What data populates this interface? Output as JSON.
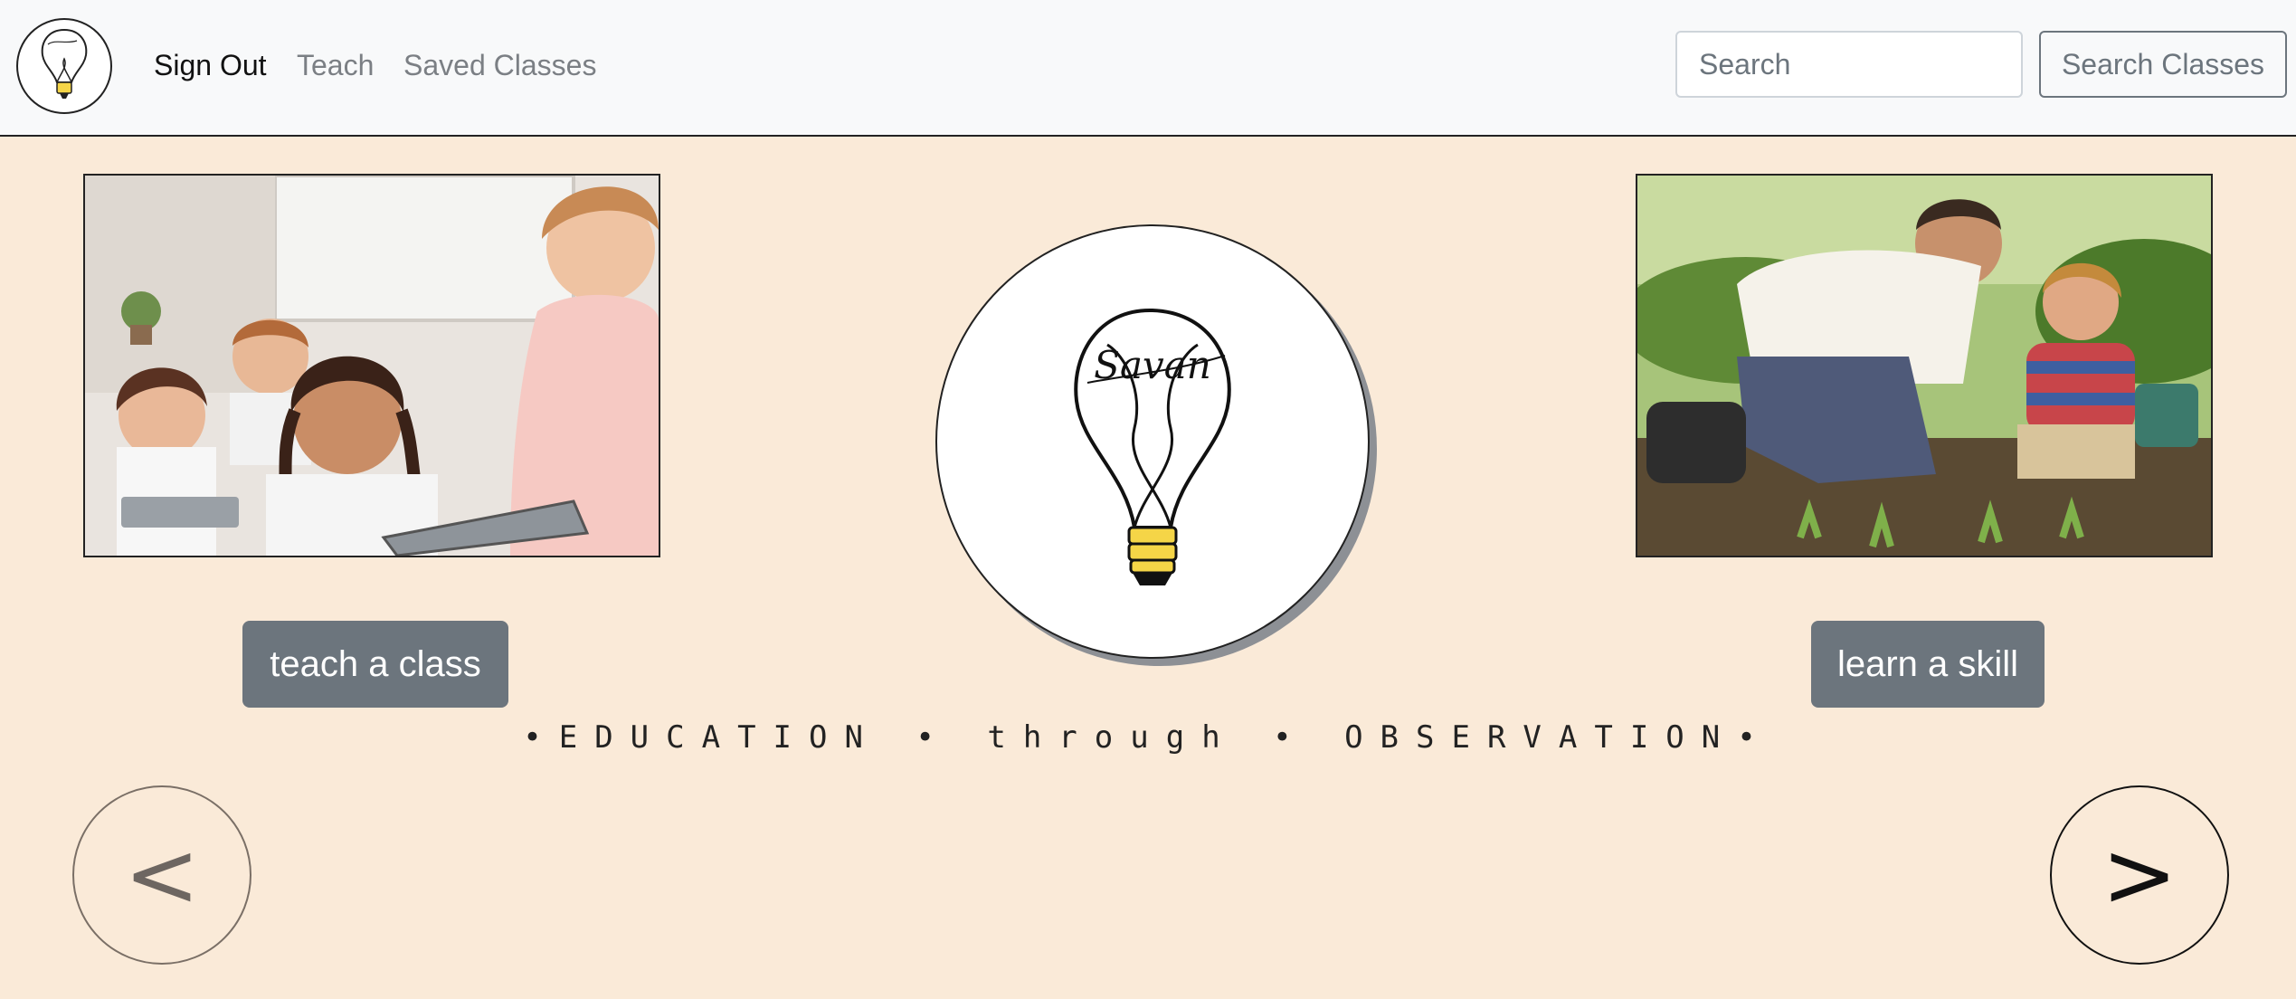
{
  "nav": {
    "links": [
      {
        "label": "Sign Out"
      },
      {
        "label": "Teach"
      },
      {
        "label": "Saved Classes"
      }
    ],
    "search_placeholder": "Search",
    "search_button": "Search Classes",
    "brand_icon": "lightbulb-logo-icon"
  },
  "hero": {
    "left_image": "children-with-tablets-photo",
    "right_image": "father-son-gardening-photo",
    "logo_signature": "Savan",
    "teach_button": "teach a class",
    "learn_button": "learn a skill",
    "tagline": "•EDUCATION • through • OBSERVATION•"
  },
  "carousel": {
    "prev_label": "<",
    "next_label": ">"
  },
  "colors": {
    "page_background": "#faead8",
    "navbar_background": "#f8f9fa",
    "button_gray": "#6c757d",
    "bulb_base": "#f5d547"
  }
}
